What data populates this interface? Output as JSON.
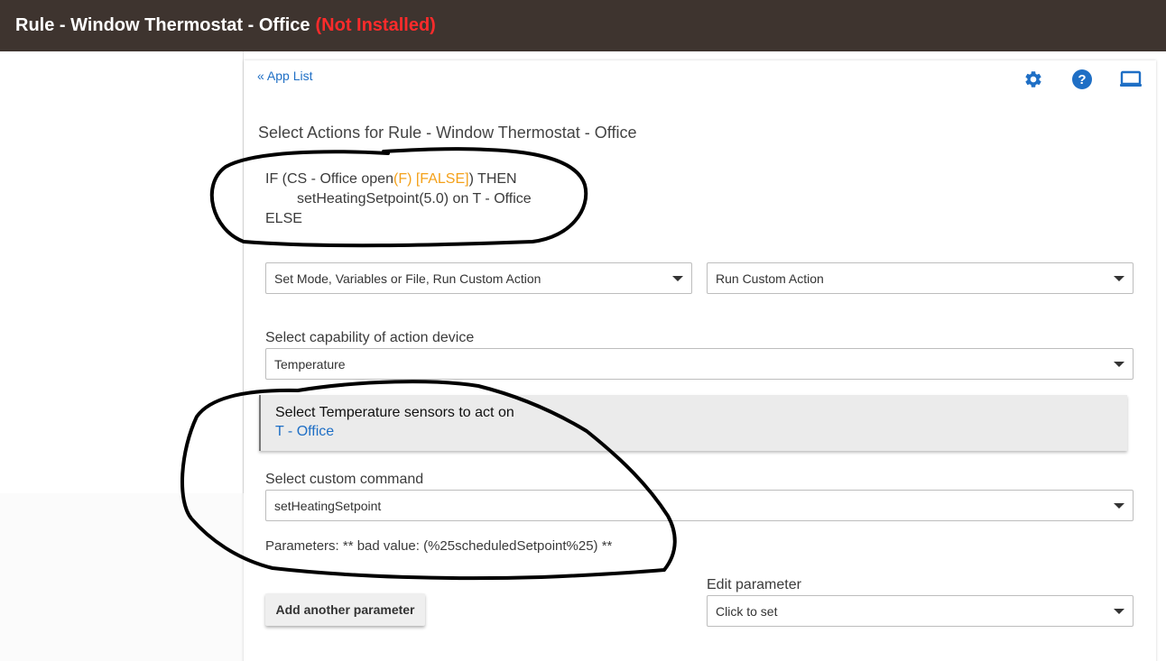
{
  "header": {
    "title": "Rule - Window Thermostat - Office",
    "status": "(Not Installed)"
  },
  "nav": {
    "app_list": "« App List"
  },
  "toolbar": {
    "icons": [
      "gear-icon",
      "help-icon",
      "laptop-icon"
    ],
    "accent_color": "#1f6fc5"
  },
  "page": {
    "title": "Select Actions for Rule - Window Thermostat - Office"
  },
  "rule": {
    "line1_prefix": "IF (CS - Office open",
    "line1_flag": "(F) [FALSE]",
    "line1_suffix": ") THEN",
    "line2": "setHeatingSetpoint(5.0) on T - Office",
    "line3": "ELSE"
  },
  "action_type": {
    "selected": "Set Mode, Variables or File, Run Custom Action"
  },
  "action_subtype": {
    "selected": "Run Custom Action"
  },
  "capability": {
    "label": "Select capability of action device",
    "selected": "Temperature"
  },
  "devices": {
    "label": "Select Temperature sensors to act on",
    "value": "T - Office"
  },
  "command": {
    "label": "Select custom command",
    "selected": "setHeatingSetpoint"
  },
  "parameters": {
    "text": "Parameters: ** bad value: (%25scheduledSetpoint%25) **"
  },
  "add_param": {
    "label": "Add another parameter"
  },
  "edit_param": {
    "label": "Edit parameter",
    "selected": "Click to set"
  }
}
